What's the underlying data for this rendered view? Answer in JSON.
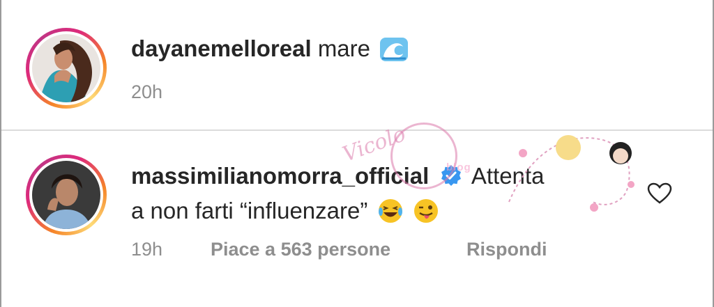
{
  "post": {
    "username": "dayanemelloreal",
    "caption": "mare",
    "caption_emoji": "wave-emoji",
    "time": "20h"
  },
  "comment": {
    "username": "massimilianomorra_official",
    "verified": true,
    "text_line1": "Attenta",
    "text_line2": "a non farti “influenzare”",
    "emojis": [
      "laughing-tears-emoji",
      "winking-tongue-emoji"
    ],
    "time": "19h",
    "likes_label": "Piace a 563 persone",
    "reply_label": "Rispondi"
  },
  "colors": {
    "username": "#262626",
    "meta": "#8e8e8e",
    "verified": "#3897f0",
    "watermark": "#db78aa"
  },
  "watermark": {
    "main": "Vicolo",
    "sub": "blog"
  }
}
